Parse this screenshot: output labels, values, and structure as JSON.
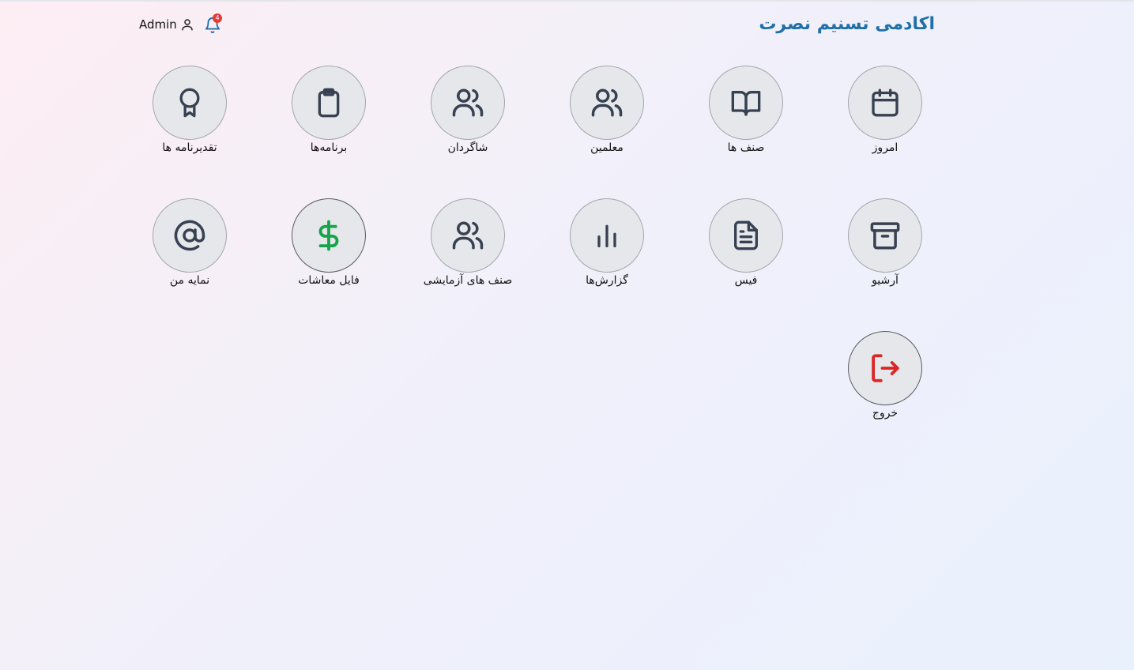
{
  "header": {
    "title": "اکادمی تسنیم نصرت",
    "user_name": "Admin",
    "notification_count": "4"
  },
  "colors": {
    "title": "#1f6fa8",
    "icon_default": "#374151",
    "icon_money": "#16a34a",
    "icon_logout": "#dc2626",
    "badge": "#e53935"
  },
  "tiles": [
    {
      "label": "امروز",
      "icon": "calendar-icon"
    },
    {
      "label": "صنف ها",
      "icon": "book-open-icon"
    },
    {
      "label": "معلمین",
      "icon": "users-icon"
    },
    {
      "label": "شاگردان",
      "icon": "users-icon"
    },
    {
      "label": "برنامه‌ها",
      "icon": "clipboard-icon"
    },
    {
      "label": "تقدیرنامه ها",
      "icon": "award-icon"
    },
    {
      "label": "آرشیو",
      "icon": "archive-icon"
    },
    {
      "label": "فیس",
      "icon": "document-icon"
    },
    {
      "label": "گزارش‌ها",
      "icon": "bar-chart-icon"
    },
    {
      "label": "صنف های آزمایشی",
      "icon": "users-icon"
    },
    {
      "label": "فایل معاشات",
      "icon": "dollar-icon"
    },
    {
      "label": "نمایه من",
      "icon": "at-sign-icon"
    },
    {
      "label": "خروج",
      "icon": "logout-icon"
    }
  ]
}
